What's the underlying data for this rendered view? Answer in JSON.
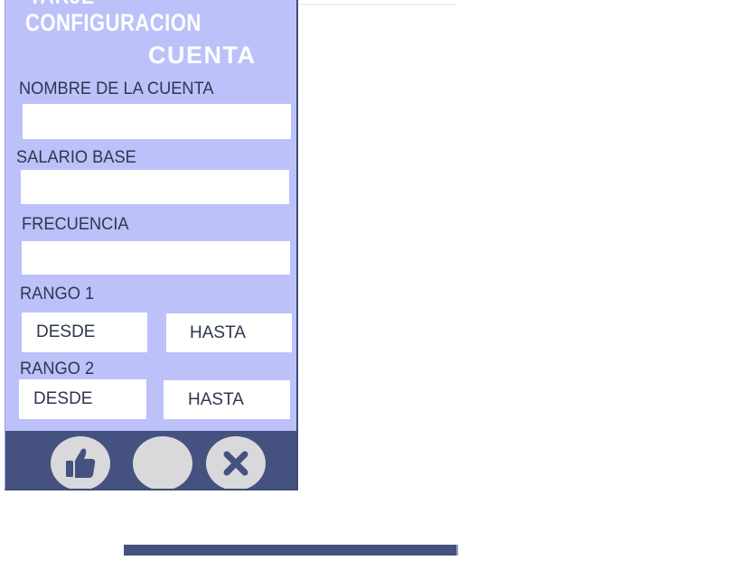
{
  "panel": {
    "clipped_title": "TARJE",
    "heading": "CONFIGURACION",
    "subheading": "CUENTA"
  },
  "form": {
    "account_name_label": "NOMBRE DE LA CUENTA",
    "account_name_value": "",
    "base_salary_label": "SALARIO BASE",
    "base_salary_value": "",
    "frequency_label": "FRECUENCIA",
    "frequency_value": "",
    "range1": {
      "label": "RANGO 1",
      "from_placeholder": "DESDE",
      "to_placeholder": "HASTA"
    },
    "range2": {
      "label": "RANGO 2",
      "from_placeholder": "DESDE",
      "to_placeholder": "HASTA"
    }
  },
  "footer": {
    "buttons": [
      {
        "icon": "thumbs-up-icon"
      },
      {
        "icon": "blank"
      },
      {
        "icon": "close-icon"
      }
    ]
  },
  "colors": {
    "panel_bg": "#bcc1f9",
    "footer_bg": "#45527f",
    "field_bg": "#ffffff",
    "button_bg": "#d9d9db",
    "icon_fg": "#45527f"
  }
}
